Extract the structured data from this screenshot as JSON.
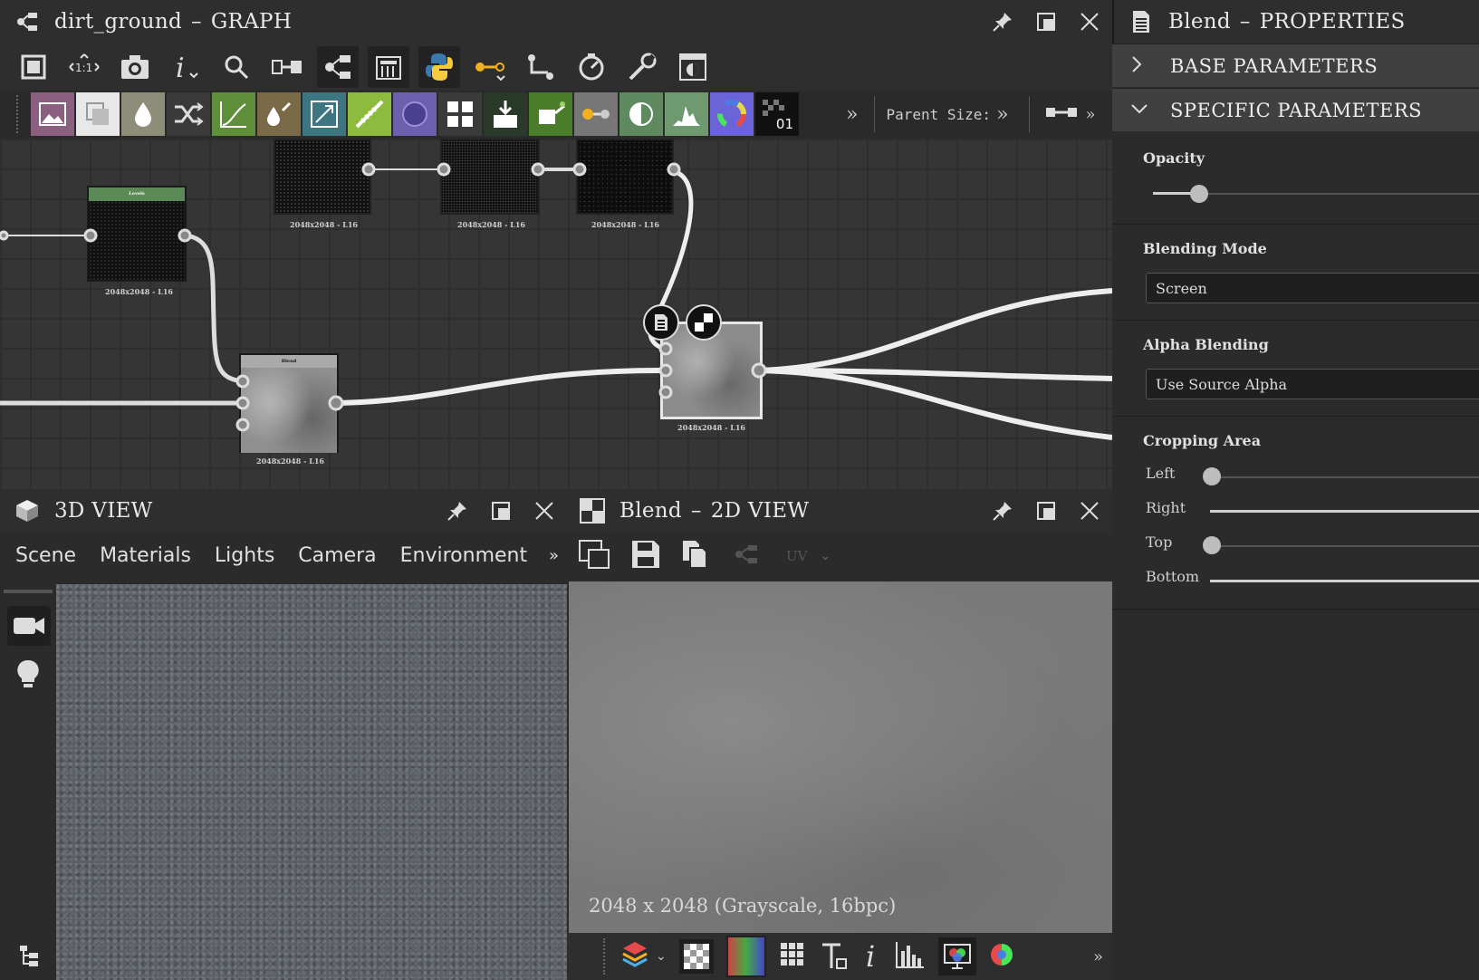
{
  "graph": {
    "title": "dirt_ground",
    "title_suffix": "GRAPH",
    "parent_size_label": "Parent Size:",
    "nodes": {
      "levels_header": "Levels",
      "blend_header": "Blend",
      "res_1": "2048x2048 - L16",
      "res_2": "2048x2048 - L16",
      "res_3": "2048x2048 - L16",
      "res_4": "2048x2048 - L16",
      "res_5": "2048x2048 - L16",
      "res_6": "2048x2048 - L16"
    },
    "tile_badge": "01"
  },
  "view3d": {
    "title": "3D VIEW",
    "tabs": [
      "Scene",
      "Materials",
      "Lights",
      "Camera",
      "Environment"
    ]
  },
  "view2d": {
    "title": "Blend",
    "title_suffix": "2D VIEW",
    "uv_label": "UV",
    "info": "2048 x 2048 (Grayscale, 16bpc)"
  },
  "props": {
    "title": "Blend",
    "title_suffix": "PROPERTIES",
    "base_section": "BASE PARAMETERS",
    "specific_section": "SPECIFIC PARAMETERS",
    "opacity_label": "Opacity",
    "opacity_value": 0.06,
    "blending_mode_label": "Blending Mode",
    "blending_mode_value": "Screen",
    "alpha_blending_label": "Alpha Blending",
    "alpha_blending_value": "Use Source Alpha",
    "cropping_label": "Cropping Area",
    "crop_left_label": "Left",
    "crop_right_label": "Right",
    "crop_top_label": "Top",
    "crop_bottom_label": "Bottom"
  }
}
